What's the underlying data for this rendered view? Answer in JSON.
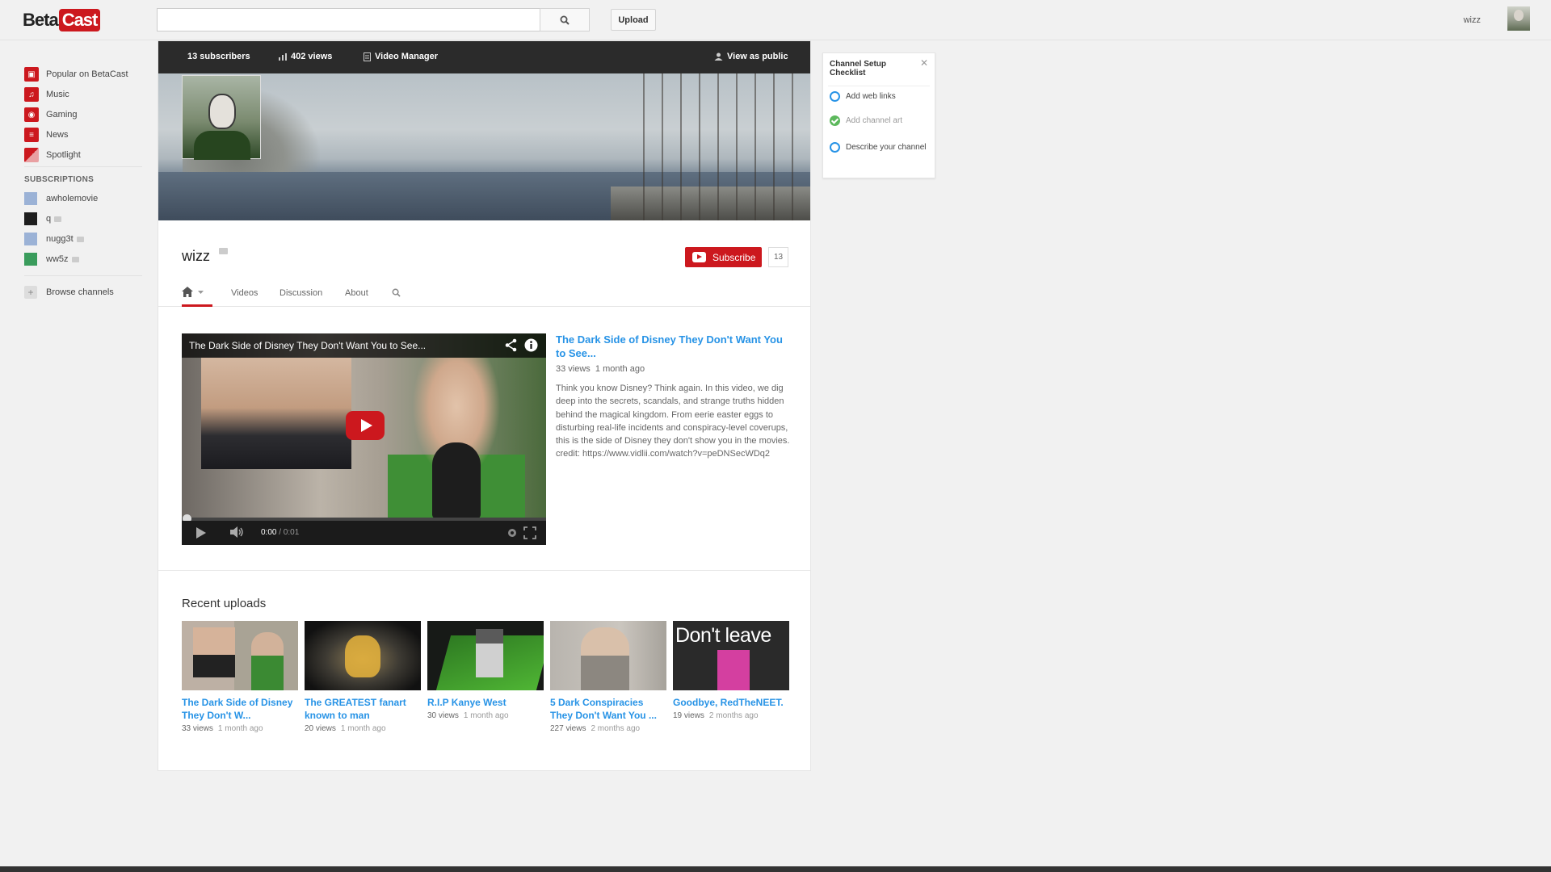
{
  "app": {
    "logo_part1": "Beta",
    "logo_part2": "Cast",
    "upload_label": "Upload",
    "user_name": "wizz",
    "accent_color": "#cc181e",
    "link_color": "#2793e6"
  },
  "search": {
    "placeholder": "",
    "value": ""
  },
  "sidebar": {
    "items": [
      {
        "label": "Popular on BetaCast",
        "icon": "popular-icon"
      },
      {
        "label": "Music",
        "icon": "music-icon"
      },
      {
        "label": "Gaming",
        "icon": "gaming-icon"
      },
      {
        "label": "News",
        "icon": "news-icon"
      },
      {
        "label": "Spotlight",
        "icon": "spotlight-icon"
      }
    ],
    "subscriptions_heading": "SUBSCRIPTIONS",
    "subscriptions": [
      {
        "label": "awholemovie"
      },
      {
        "label": "q"
      },
      {
        "label": "nugg3t"
      },
      {
        "label": "ww5z"
      }
    ],
    "browse_label": "Browse channels"
  },
  "stats_bar": {
    "subscribers": "13 subscribers",
    "views": "402 views",
    "video_manager": "Video Manager",
    "view_as_public": "View as public"
  },
  "channel": {
    "name": "wizz",
    "subscribe_label": "Subscribe",
    "subscriber_count": "13",
    "tabs": [
      "Videos",
      "Discussion",
      "About"
    ]
  },
  "featured": {
    "player_title": "The Dark Side of Disney They Don't Want You to See...",
    "time_current": "0:00",
    "time_total": "/ 0:01",
    "title": "The Dark Side of Disney They Don't Want You to See...",
    "views": "33 views",
    "age": "1 month ago",
    "description": "Think you know Disney? Think again. In this video, we dig deep into the secrets, scandals, and strange truths hidden behind the magical kingdom. From eerie easter eggs to disturbing real-life incidents and conspiracy-level coverups, this is the side of Disney they don't show you in the movies. credit: https://www.vidlii.com/watch?v=peDNSecWDq2"
  },
  "recent": {
    "heading": "Recent uploads",
    "videos": [
      {
        "title": "The Dark Side of Disney They Don't W...",
        "views": "33 views",
        "age": "1 month ago",
        "thumb_text": ""
      },
      {
        "title": "The GREATEST fanart known to man",
        "views": "20 views",
        "age": "1 month ago",
        "thumb_text": ""
      },
      {
        "title": "R.I.P Kanye West",
        "views": "30 views",
        "age": "1 month ago",
        "thumb_text": ""
      },
      {
        "title": "5 Dark Conspiracies They Don't Want You ...",
        "views": "227 views",
        "age": "2 months ago",
        "thumb_text": ""
      },
      {
        "title": "Goodbye, RedTheNEET.",
        "views": "19 views",
        "age": "2 months ago",
        "thumb_text": "Don't leave"
      }
    ]
  },
  "checklist": {
    "title": "Channel Setup Checklist",
    "items": [
      {
        "label": "Add web links",
        "done": false
      },
      {
        "label": "Add channel art",
        "done": true
      },
      {
        "label": "Describe your channel",
        "done": false
      }
    ]
  }
}
